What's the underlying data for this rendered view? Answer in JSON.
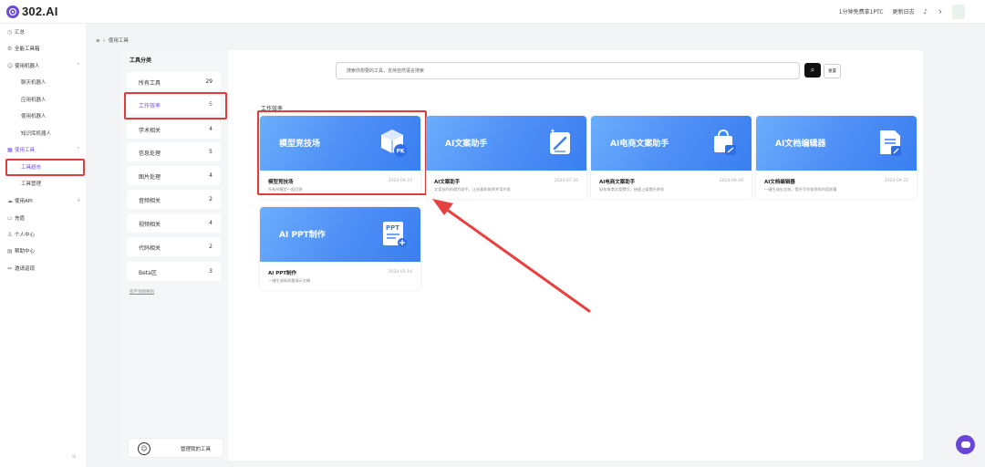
{
  "app": {
    "logo_text": "302.AI"
  },
  "topbar": {
    "promo": "1分钟免费拿1PTC",
    "changelog": "更新日志"
  },
  "sidebar": {
    "items": [
      {
        "label": "汇总",
        "icon": "dashboard-icon"
      },
      {
        "label": "全能工具箱",
        "icon": "toolbox-icon"
      },
      {
        "label": "使用机器人",
        "icon": "robot-icon"
      },
      {
        "label": "聊天机器人",
        "icon": ""
      },
      {
        "label": "应用机器人",
        "icon": ""
      },
      {
        "label": "使用机器人",
        "icon": ""
      },
      {
        "label": "知识库机器人",
        "icon": ""
      },
      {
        "label": "使用工具",
        "icon": "tools-icon"
      },
      {
        "label": "工具超市",
        "icon": ""
      },
      {
        "label": "工具管理",
        "icon": ""
      },
      {
        "label": "使用API",
        "icon": "api-icon"
      },
      {
        "label": "充值",
        "icon": "recharge-icon"
      },
      {
        "label": "个人中心",
        "icon": "user-icon"
      },
      {
        "label": "帮助中心",
        "icon": "help-icon"
      },
      {
        "label": "邀请返现",
        "icon": "invite-icon"
      }
    ]
  },
  "breadcrumb": {
    "current": "使用工具"
  },
  "categories": {
    "title": "工具分类",
    "items": [
      {
        "label": "所有工具",
        "count": "29"
      },
      {
        "label": "工作效率",
        "count": "5"
      },
      {
        "label": "学术相关",
        "count": "4"
      },
      {
        "label": "信息处理",
        "count": "5"
      },
      {
        "label": "图片处理",
        "count": "4"
      },
      {
        "label": "音频相关",
        "count": "2"
      },
      {
        "label": "视频相关",
        "count": "4"
      },
      {
        "label": "代码相关",
        "count": "2"
      },
      {
        "label": "Beta区",
        "count": "3"
      }
    ],
    "link": "找不到想要的",
    "manage_label": "管理我的工具"
  },
  "search": {
    "placeholder": "搜索你想要的工具，支持自然语言搜索",
    "reset_label": "重置"
  },
  "section": {
    "title": "工作效率"
  },
  "cards": [
    {
      "banner_title": "模型竞技场",
      "title": "模型竞技场",
      "date": "2024-04-23",
      "desc": "所有AI模型一起回答",
      "icon": "pk-cube-icon"
    },
    {
      "banner_title": "AI文案助手",
      "title": "AI文案助手",
      "date": "2024-07-26",
      "desc": "文案创作的得力助手，让创意和效率并驾齐驱",
      "icon": "pen-document-icon"
    },
    {
      "banner_title": "AI电商文案助手",
      "title": "AI电商文案助手",
      "date": "2024-09-28",
      "desc": "轻松电商文案撰写，快速上架提升转化",
      "icon": "shopping-bag-icon"
    },
    {
      "banner_title": "AI文档编辑器",
      "title": "AI文档编辑器",
      "date": "2024-09-22",
      "desc": "一键生成长文档，提升写作效率和内容质量",
      "icon": "document-edit-icon"
    },
    {
      "banner_title": "AI PPT制作",
      "title": "AI PPT制作",
      "date": "2024-05-16",
      "desc": "一键生成高质量演示文稿",
      "icon": "ppt-icon"
    }
  ],
  "colors": {
    "accent": "#7a4fe0",
    "highlight": "#e23b3b",
    "banner": "#4d8df6"
  }
}
